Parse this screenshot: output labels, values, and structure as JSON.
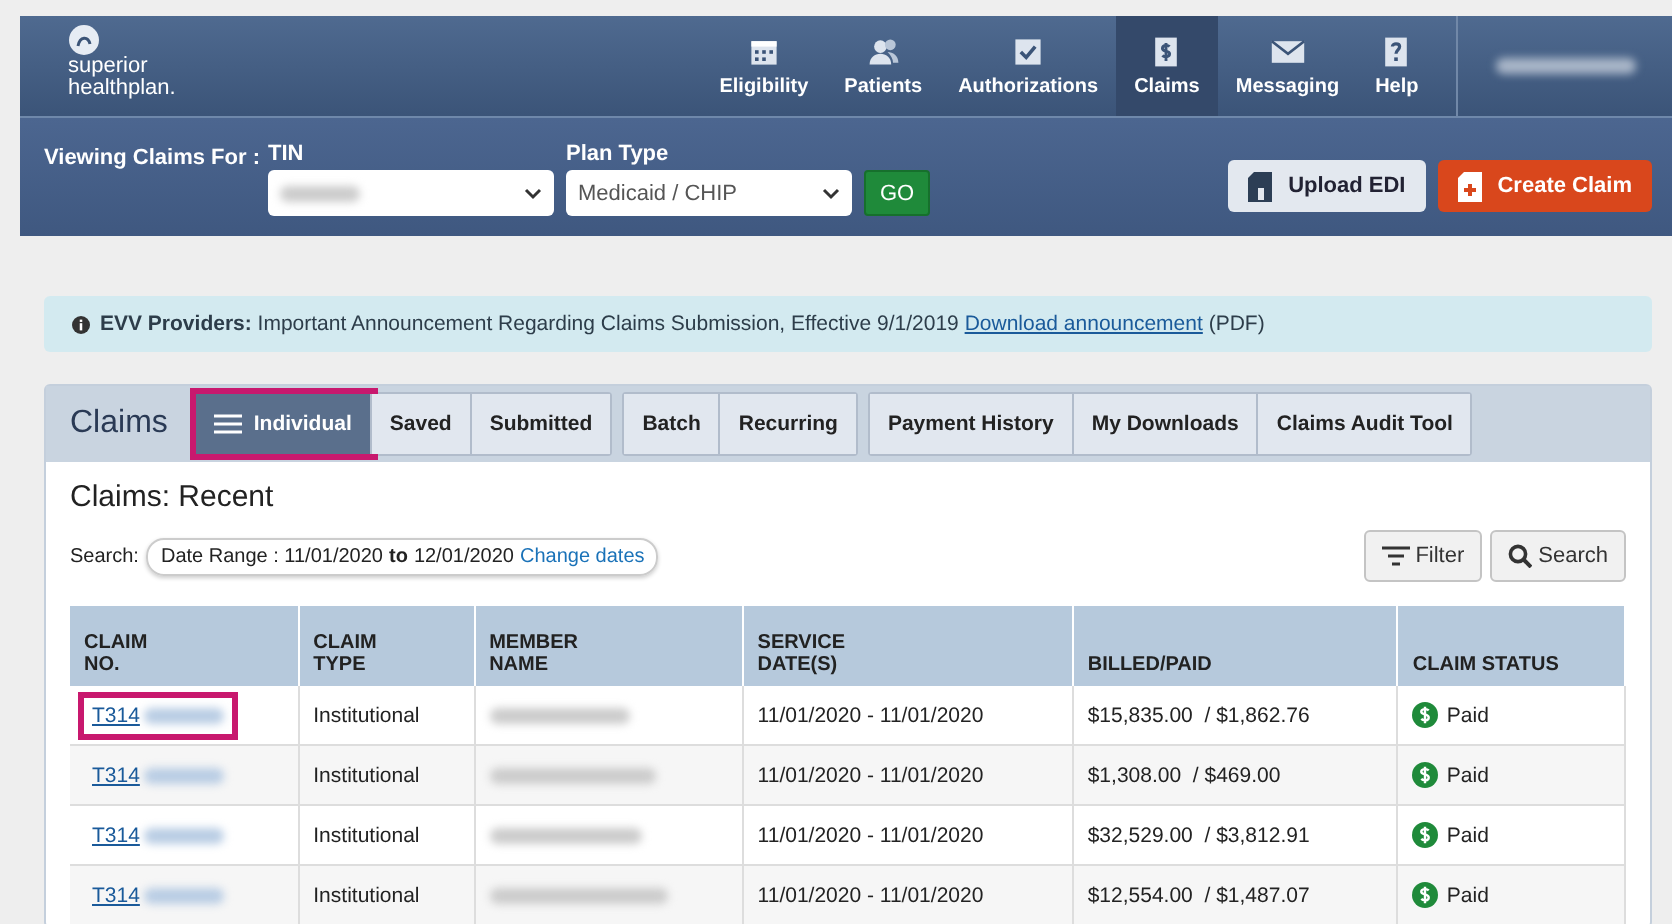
{
  "logo": {
    "line1": "superior",
    "line2": "healthplan."
  },
  "nav": [
    {
      "label": "Eligibility",
      "selected": false
    },
    {
      "label": "Patients",
      "selected": false
    },
    {
      "label": "Authorizations",
      "selected": false
    },
    {
      "label": "Claims",
      "selected": true
    },
    {
      "label": "Messaging",
      "selected": false
    },
    {
      "label": "Help",
      "selected": false
    }
  ],
  "filter_bar": {
    "viewing_label": "Viewing Claims For :",
    "tin_label": "TIN",
    "plan_label": "Plan Type",
    "plan_value": "Medicaid / CHIP",
    "go": "GO",
    "upload": "Upload EDI",
    "create": "Create Claim"
  },
  "notice": {
    "bold": "EVV Providers:",
    "text": "Important Announcement Regarding Claims Submission, Effective 9/1/2019",
    "link": "Download announcement",
    "suffix": "(PDF)"
  },
  "claims_title": "Claims",
  "tab_groups": [
    [
      {
        "label": "Individual",
        "selected": true,
        "highlighted": true
      },
      {
        "label": "Saved",
        "selected": false,
        "highlighted": false
      },
      {
        "label": "Submitted",
        "selected": false,
        "highlighted": false
      }
    ],
    [
      {
        "label": "Batch",
        "selected": false,
        "highlighted": false
      },
      {
        "label": "Recurring",
        "selected": false,
        "highlighted": false
      }
    ],
    [
      {
        "label": "Payment History",
        "selected": false,
        "highlighted": false
      },
      {
        "label": "My Downloads",
        "selected": false,
        "highlighted": false
      },
      {
        "label": "Claims Audit Tool",
        "selected": false,
        "highlighted": false
      }
    ]
  ],
  "panel_title": "Claims: Recent",
  "search": {
    "label": "Search:",
    "range_label": "Date Range : 11/01/2020",
    "to": "to",
    "end": "12/01/2020",
    "change": "Change dates",
    "filter": "Filter",
    "search_button": "Search"
  },
  "table": {
    "columns": [
      [
        "CLAIM",
        "NO."
      ],
      [
        "CLAIM",
        "TYPE"
      ],
      [
        "MEMBER",
        "NAME"
      ],
      [
        "SERVICE",
        "DATE(S)"
      ],
      [
        "BILLED/PAID"
      ],
      [
        "CLAIM STATUS"
      ]
    ],
    "rows": [
      {
        "claim_no": "T314",
        "highlighted": true,
        "type": "Institutional",
        "dates": "11/01/2020 - 11/01/2020",
        "billed": "$15,835.00",
        "paid": "/ $1,862.76",
        "status": "Paid"
      },
      {
        "claim_no": "T314",
        "highlighted": false,
        "type": "Institutional",
        "dates": "11/01/2020 - 11/01/2020",
        "billed": "$1,308.00",
        "paid": "/ $469.00",
        "status": "Paid"
      },
      {
        "claim_no": "T314",
        "highlighted": false,
        "type": "Institutional",
        "dates": "11/01/2020 - 11/01/2020",
        "billed": "$32,529.00",
        "paid": "/ $3,812.91",
        "status": "Paid"
      },
      {
        "claim_no": "T314",
        "highlighted": false,
        "type": "Institutional",
        "dates": "11/01/2020 - 11/01/2020",
        "billed": "$12,554.00",
        "paid": "/ $1,487.07",
        "status": "Paid"
      }
    ]
  }
}
